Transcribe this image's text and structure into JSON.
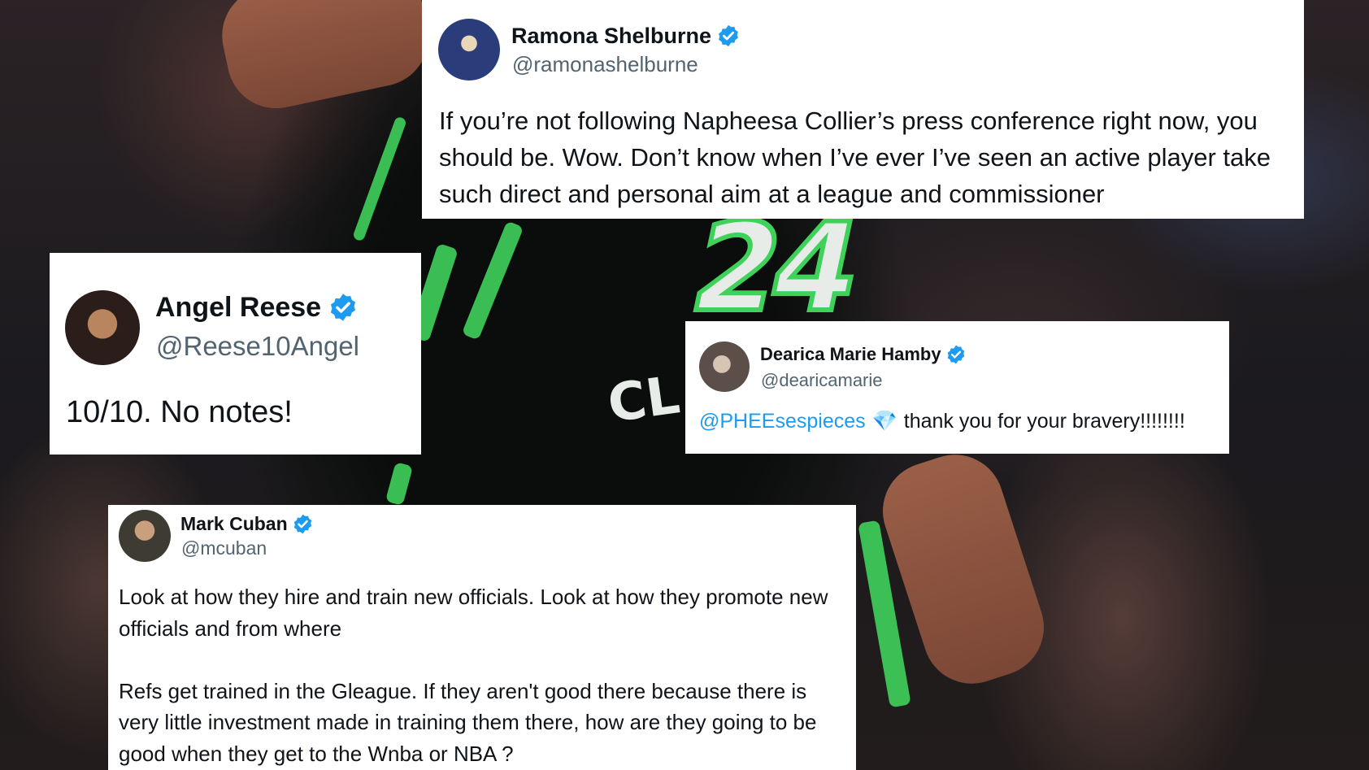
{
  "tweets": {
    "ramona": {
      "name": "Ramona Shelburne",
      "handle": "@ramonashelburne",
      "text": "If you’re not following Napheesa Collier’s press conference right now, you should be. Wow. Don’t know when I’ve ever I’ve seen an active player take such direct and personal aim at a league and commissioner"
    },
    "angel": {
      "name": "Angel Reese",
      "handle": "@Reese10Angel",
      "text": "10/10. No notes!"
    },
    "dearica": {
      "name": "Dearica Marie Hamby",
      "handle": "@dearicamarie",
      "mention": "@PHEEsespieces",
      "emoji": "💎",
      "text": "thank you for your bravery!!!!!!!!"
    },
    "mark": {
      "name": "Mark Cuban",
      "handle": "@mcuban",
      "text": "Look at how they hire and train new officials.  Look at how they promote new officials and from where\n\nRefs get trained in the Gleague.  If they aren't good there because there is very little  investment made in training them there, how are they going to be good when they get to the Wnba or NBA ?"
    }
  },
  "background": {
    "jersey_number": "24",
    "jersey_letters": "CL"
  },
  "colors": {
    "verified": "#1d9bf0",
    "mention": "#1d9bf0",
    "jersey_accent": "#3fd25b"
  }
}
